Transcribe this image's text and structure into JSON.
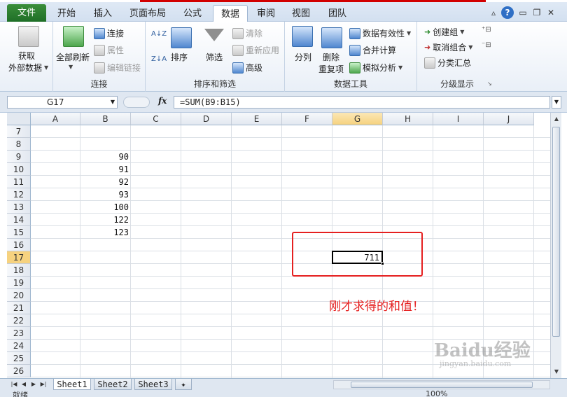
{
  "ribbon_tabs": {
    "file": "文件",
    "home": "开始",
    "insert": "插入",
    "page_layout": "页面布局",
    "formulas": "公式",
    "data": "数据",
    "review": "审阅",
    "view": "视图",
    "team": "团队"
  },
  "groups": {
    "external": {
      "label_line1": "获取",
      "label_line2": "外部数据"
    },
    "connections": {
      "refresh_all": "全部刷新",
      "connections": "连接",
      "properties": "属性",
      "edit_links": "编辑链接",
      "group_label": "连接"
    },
    "sort_filter": {
      "sort": "排序",
      "filter": "筛选",
      "clear": "清除",
      "reapply": "重新应用",
      "advanced": "高级",
      "group_label": "排序和筛选"
    },
    "data_tools": {
      "text_to_columns": "分列",
      "remove_dup_line1": "删除",
      "remove_dup_line2": "重复项",
      "validation": "数据有效性",
      "consolidate": "合并计算",
      "whatif": "模拟分析",
      "group_label": "数据工具"
    },
    "outline": {
      "group": "创建组",
      "ungroup": "取消组合",
      "subtotal": "分类汇总",
      "group_label": "分级显示"
    }
  },
  "formula_bar": {
    "name_box": "G17",
    "fx": "fx",
    "formula": "=SUM(B9:B15)"
  },
  "columns": [
    "A",
    "B",
    "C",
    "D",
    "E",
    "F",
    "G",
    "H",
    "I",
    "J"
  ],
  "rows": [
    "7",
    "8",
    "9",
    "10",
    "11",
    "12",
    "13",
    "14",
    "15",
    "16",
    "17",
    "18",
    "19",
    "20",
    "21",
    "22",
    "23",
    "24",
    "25",
    "26"
  ],
  "selected": {
    "column": "G",
    "row": "17"
  },
  "cells": {
    "b9": "90",
    "b10": "91",
    "b11": "92",
    "b12": "93",
    "b13": "100",
    "b14": "122",
    "b15": "123",
    "g17": "711"
  },
  "annotation": "刚才求得的和值！",
  "sheets": [
    "Sheet1",
    "Sheet2",
    "Sheet3"
  ],
  "status": {
    "ready": "就绪",
    "zoom": "100%"
  },
  "watermark": {
    "main": "Baidu经验",
    "sub": "jingyan.baidu.com"
  },
  "colors": {
    "annotation_red": "#e52020",
    "file_tab_green": "#1f6f27",
    "selected_header": "#f6d27f"
  }
}
